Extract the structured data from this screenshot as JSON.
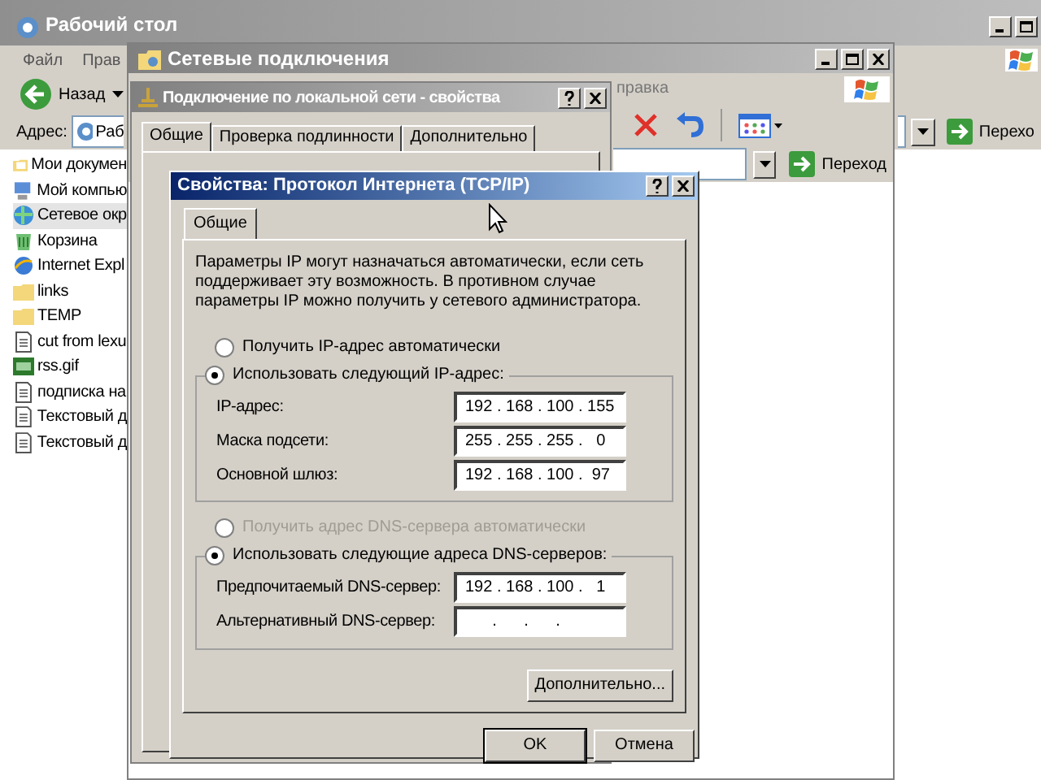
{
  "desktop_window": {
    "title": "Рабочий стол",
    "menu": [
      "Файл",
      "Прав"
    ],
    "back_button": "Назад",
    "address_label": "Адрес:",
    "address_value": "Раб",
    "go_button": "Перехо",
    "files": [
      {
        "name": "Мои докумен",
        "kind": "documents",
        "selected": false
      },
      {
        "name": "Мой компью",
        "kind": "computer",
        "selected": false
      },
      {
        "name": "Сетевое окр",
        "kind": "network",
        "selected": true
      },
      {
        "name": "Корзина",
        "kind": "recycle",
        "selected": false
      },
      {
        "name": "Internet Expl",
        "kind": "browser",
        "selected": false
      },
      {
        "name": "links",
        "kind": "folder",
        "selected": false
      },
      {
        "name": "TEMP",
        "kind": "folder",
        "selected": false
      },
      {
        "name": "cut from lexu",
        "kind": "text",
        "selected": false
      },
      {
        "name": "rss.gif",
        "kind": "image",
        "selected": false
      },
      {
        "name": "подписка на",
        "kind": "text",
        "selected": false
      },
      {
        "name": "Текстовый д",
        "kind": "text",
        "selected": false
      },
      {
        "name": "Текстовый д",
        "kind": "text",
        "selected": false
      }
    ]
  },
  "network_window": {
    "title": "Сетевые подключения",
    "menu": [
      "правка"
    ],
    "go_button": "Переход"
  },
  "connection_dialog": {
    "title": "Подключение по локальной сети - свойства",
    "tabs": [
      {
        "label": "Общие",
        "selected": true
      },
      {
        "label": "Проверка подлинности",
        "selected": false
      },
      {
        "label": "Дополнительно",
        "selected": false
      }
    ]
  },
  "tcpip_dialog": {
    "title": "Свойства: Протокол Интернета (TCP/IP)",
    "tabs": [
      {
        "label": "Общие",
        "selected": true
      }
    ],
    "description": "Параметры IP могут назначаться автоматически, если сеть поддерживает эту возможность. В противном случае параметры IP можно получить у сетевого администратора.",
    "ip_options": [
      {
        "label": "Получить IP-адрес автоматически",
        "selected": false,
        "disabled": false
      },
      {
        "label": "Использовать следующий IP-адрес:",
        "selected": true,
        "disabled": false
      }
    ],
    "ip_fields": [
      {
        "label": "IP-адрес:",
        "value": "192 . 168 . 100 . 155"
      },
      {
        "label": "Маска подсети:",
        "value": "255 . 255 . 255 .   0"
      },
      {
        "label": "Основной шлюз:",
        "value": "192 . 168 . 100 .  97"
      }
    ],
    "dns_options": [
      {
        "label": "Получить адрес DNS-сервера автоматически",
        "selected": false,
        "disabled": true
      },
      {
        "label": "Использовать следующие адреса DNS-серверов:",
        "selected": true,
        "disabled": false
      }
    ],
    "dns_fields": [
      {
        "label": "Предпочитаемый DNS-сервер:",
        "value": "192 . 168 . 100 .   1"
      },
      {
        "label": "Альтернативный DNS-сервер:",
        "value": "      .      .      ."
      }
    ],
    "advanced_button": "Дополнительно...",
    "buttons": [
      "OK",
      "Отмена"
    ]
  }
}
